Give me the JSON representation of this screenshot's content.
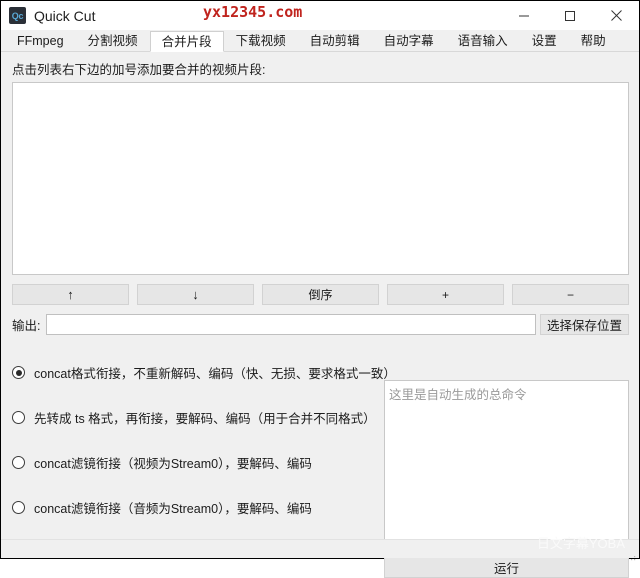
{
  "window": {
    "title": "Quick Cut",
    "icon_label": "Qc",
    "icon_name": "app-icon",
    "controls": {
      "minimize": "minimize-icon",
      "maximize": "maximize-icon",
      "close": "close-icon"
    }
  },
  "watermarks": {
    "top": "yx12345.com",
    "top_color": "#c0241e",
    "bottom": "日文字幕YOBA"
  },
  "tabs": [
    {
      "label": "FFmpeg",
      "active": false
    },
    {
      "label": "分割视频",
      "active": false
    },
    {
      "label": "合并片段",
      "active": true
    },
    {
      "label": "下载视频",
      "active": false
    },
    {
      "label": "自动剪辑",
      "active": false
    },
    {
      "label": "自动字幕",
      "active": false
    },
    {
      "label": "语音输入",
      "active": false
    },
    {
      "label": "设置",
      "active": false
    },
    {
      "label": "帮助",
      "active": false
    }
  ],
  "main": {
    "hint": "点击列表右下边的加号添加要合并的视频片段:",
    "file_list_items": [],
    "order_buttons": [
      {
        "label": "↑",
        "name": "move-up-button"
      },
      {
        "label": "↓",
        "name": "move-down-button"
      },
      {
        "label": "倒序",
        "name": "reverse-order-button"
      },
      {
        "label": "+",
        "name": "add-clip-button"
      },
      {
        "label": "−",
        "name": "remove-clip-button"
      }
    ],
    "output": {
      "label": "输出:",
      "value": "",
      "placeholder": "",
      "browse_label": "选择保存位置"
    },
    "modes": [
      {
        "label": "concat格式衔接，不重新解码、编码（快、无损、要求格式一致）",
        "checked": true
      },
      {
        "label": "先转成 ts 格式，再衔接，要解码、编码（用于合并不同格式）",
        "checked": false
      },
      {
        "label": "concat滤镜衔接（视频为Stream0），要解码、编码",
        "checked": false
      },
      {
        "label": "concat滤镜衔接（音频为Stream0），要解码、编码",
        "checked": false
      }
    ],
    "command": {
      "placeholder": "这里是自动生成的总命令",
      "value": ""
    },
    "run_label": "运行"
  }
}
